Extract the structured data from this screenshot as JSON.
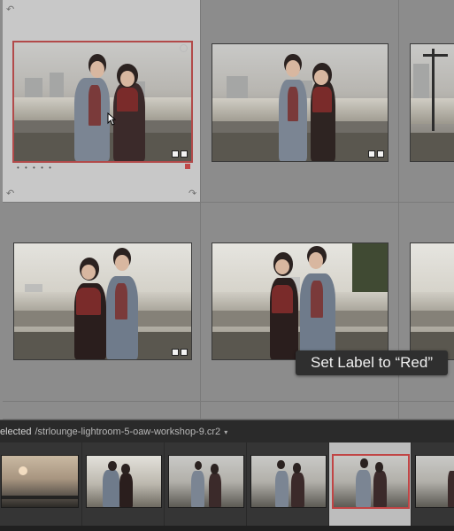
{
  "grid": {
    "cells": [
      {
        "name": "grid-cell-1",
        "selected": true,
        "color_label": "red"
      },
      {
        "name": "grid-cell-2",
        "selected": false
      },
      {
        "name": "grid-cell-3",
        "selected": false
      },
      {
        "name": "grid-cell-4",
        "selected": false
      },
      {
        "name": "grid-cell-5",
        "selected": false
      },
      {
        "name": "grid-cell-6",
        "selected": false
      }
    ],
    "stars_placeholder": "• • • • •"
  },
  "tooltip": {
    "text": "Set Label to “Red”"
  },
  "filmstrip": {
    "header_selected": "elected",
    "header_path": "/strlounge-lightroom-5-oaw-workshop-9.cr2",
    "header_caret": "▾",
    "thumb_count": 6,
    "active_index": 4
  },
  "colors": {
    "label_red": "#c04848",
    "tooltip_bg": "#2f2f2f",
    "grid_bg": "#8c8c8c",
    "selected_cell_bg": "#c8c8c8"
  }
}
